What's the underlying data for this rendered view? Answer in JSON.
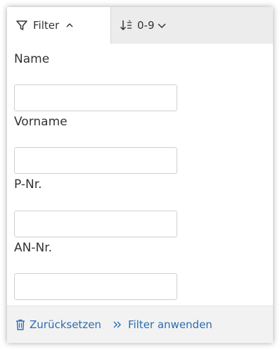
{
  "toolbar": {
    "filter_tab": {
      "label": "Filter",
      "icon": "filter-funnel-icon",
      "toggle_icon": "chevron-up-icon"
    },
    "sort_tab": {
      "label": "0-9",
      "icon": "sort-numeric-icon",
      "toggle_icon": "chevron-down-icon"
    }
  },
  "form": {
    "fields": [
      {
        "label": "Name",
        "value": "",
        "placeholder": ""
      },
      {
        "label": "Vorname",
        "value": "",
        "placeholder": ""
      },
      {
        "label": "P-Nr.",
        "value": "",
        "placeholder": ""
      },
      {
        "label": "AN-Nr.",
        "value": "",
        "placeholder": ""
      }
    ]
  },
  "footer": {
    "reset_label": "Zurücksetzen",
    "reset_icon": "trash-icon",
    "apply_label": "Filter anwenden",
    "apply_icon": "double-chevron-right-icon"
  },
  "colors": {
    "link": "#2b6cb0",
    "toolbar_bg": "#ececec",
    "footer_bg": "#f2f2f2"
  }
}
